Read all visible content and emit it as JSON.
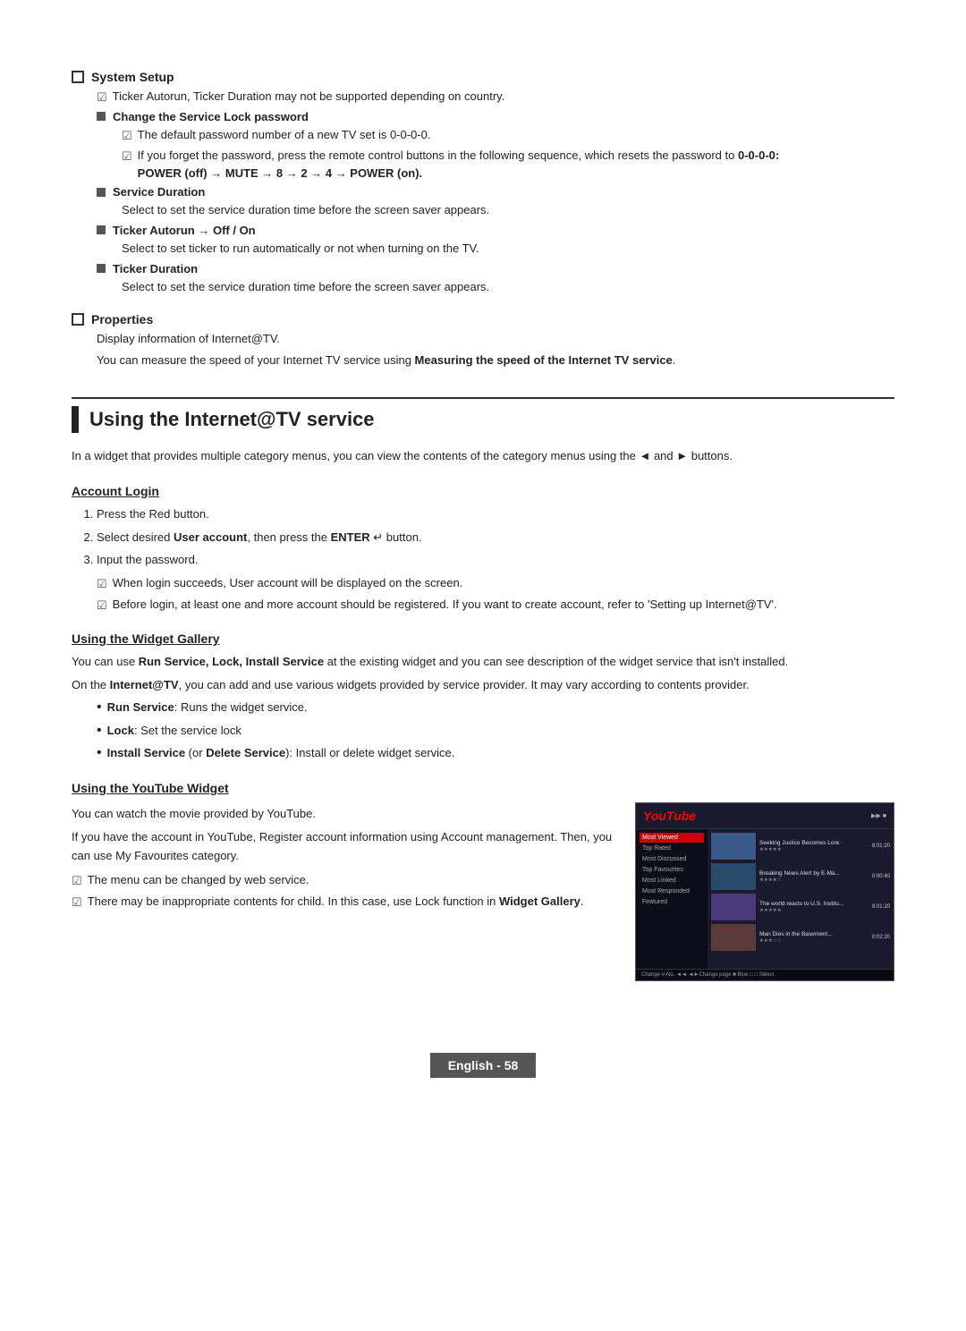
{
  "system_setup": {
    "heading": "System Setup",
    "note1": "Ticker Autorun, Ticker Duration may not be supported depending on country.",
    "change_service_lock": {
      "heading": "Change the Service Lock password",
      "note1": "The default password number of a new TV set is 0-0-0-0.",
      "note2_prefix": "If you forget the password, press the remote control buttons in the following sequence, which resets the password to ",
      "note2_bold": "0-0-0-0:",
      "note2_sequence": "POWER (off) → MUTE → 8 → 2 → 4 → POWER (on)."
    },
    "service_duration": {
      "heading": "Service Duration",
      "text": "Select to set the service duration time before the screen saver appears."
    },
    "ticker_autorun": {
      "heading": "Ticker Autorun → Off / On",
      "text": "Select to set ticker to run automatically or not when turning on the TV."
    },
    "ticker_duration": {
      "heading": "Ticker Duration",
      "text": "Select to set the service duration time before the screen saver appears."
    }
  },
  "properties": {
    "heading": "Properties",
    "line1": "Display information of Internet@TV.",
    "line2_prefix": "You can measure the speed of your Internet TV service using ",
    "line2_bold": "Measuring the speed of the Internet TV service",
    "line2_suffix": "."
  },
  "major_section": {
    "title": "Using the Internet@TV service",
    "intro": "In a widget that provides multiple category menus, you can view the contents of the category menus using the ◄ and ► buttons."
  },
  "account_login": {
    "heading": "Account Login",
    "step1": "Press the Red button.",
    "step2_prefix": "Select desired ",
    "step2_bold": "User account",
    "step2_suffix": ", then press the ",
    "step2_bold2": "ENTER",
    "step2_enter": "↵",
    "step2_end": " button.",
    "step3": "Input the password.",
    "note1": "When login succeeds, User account will be displayed on the screen.",
    "note2": "Before login, at least one and more account should be registered. If you want to create account, refer to 'Setting up Internet@TV'."
  },
  "widget_gallery": {
    "heading": "Using the Widget Gallery",
    "line1_bold": "Run Service, Lock, Install Service",
    "line1_suffix": " at the existing widget and you can see description of the widget service that isn't installed.",
    "line2_prefix": "On the ",
    "line2_bold": "Internet@TV",
    "line2_suffix": ", you can add and use various widgets provided by service provider. It may vary according to contents provider.",
    "bullet1_bold": "Run Service",
    "bullet1_suffix": ": Runs the widget service.",
    "bullet2_bold": "Lock",
    "bullet2_suffix": ": Set the service lock",
    "bullet3_bold": "Install Service",
    "bullet3_or": " (or ",
    "bullet3_bold2": "Delete Service",
    "bullet3_suffix": "): Install or delete widget service."
  },
  "youtube_widget": {
    "heading": "Using the YouTube Widget",
    "line1": "You can watch the movie provided by YouTube.",
    "line2": "If you have the account in YouTube, Register account information using Account management. Then, you can use My Favourites category.",
    "note1": "The menu can be changed by web service.",
    "note2_prefix": "There may be inappropriate contents for child. In this case, use Lock function in ",
    "note2_bold": "Widget Gallery",
    "note2_suffix": ".",
    "screenshot": {
      "title": "YouTube",
      "sidebar_items": [
        "Most Viewed",
        "Top Rated",
        "Most Discussed",
        "Top Favourites",
        "Most Linked",
        "Most Responded",
        "Featured"
      ],
      "videos": [
        {
          "title": "Seeking Justice Becomes Lore",
          "duration": "8:01:20"
        },
        {
          "title": "Breaking News Alert by E-Ma...",
          "duration": "0:00:40"
        },
        {
          "title": "The world reacts to U.S. Institu...",
          "duration": "8:01:20"
        },
        {
          "title": "Man Dies in the Basement...",
          "duration": "0:02:20"
        }
      ],
      "footer": "Change #-No. ◄◄ ◄►Change page ■ Blue □ □ Select"
    }
  },
  "footer": {
    "label": "English - 58"
  }
}
